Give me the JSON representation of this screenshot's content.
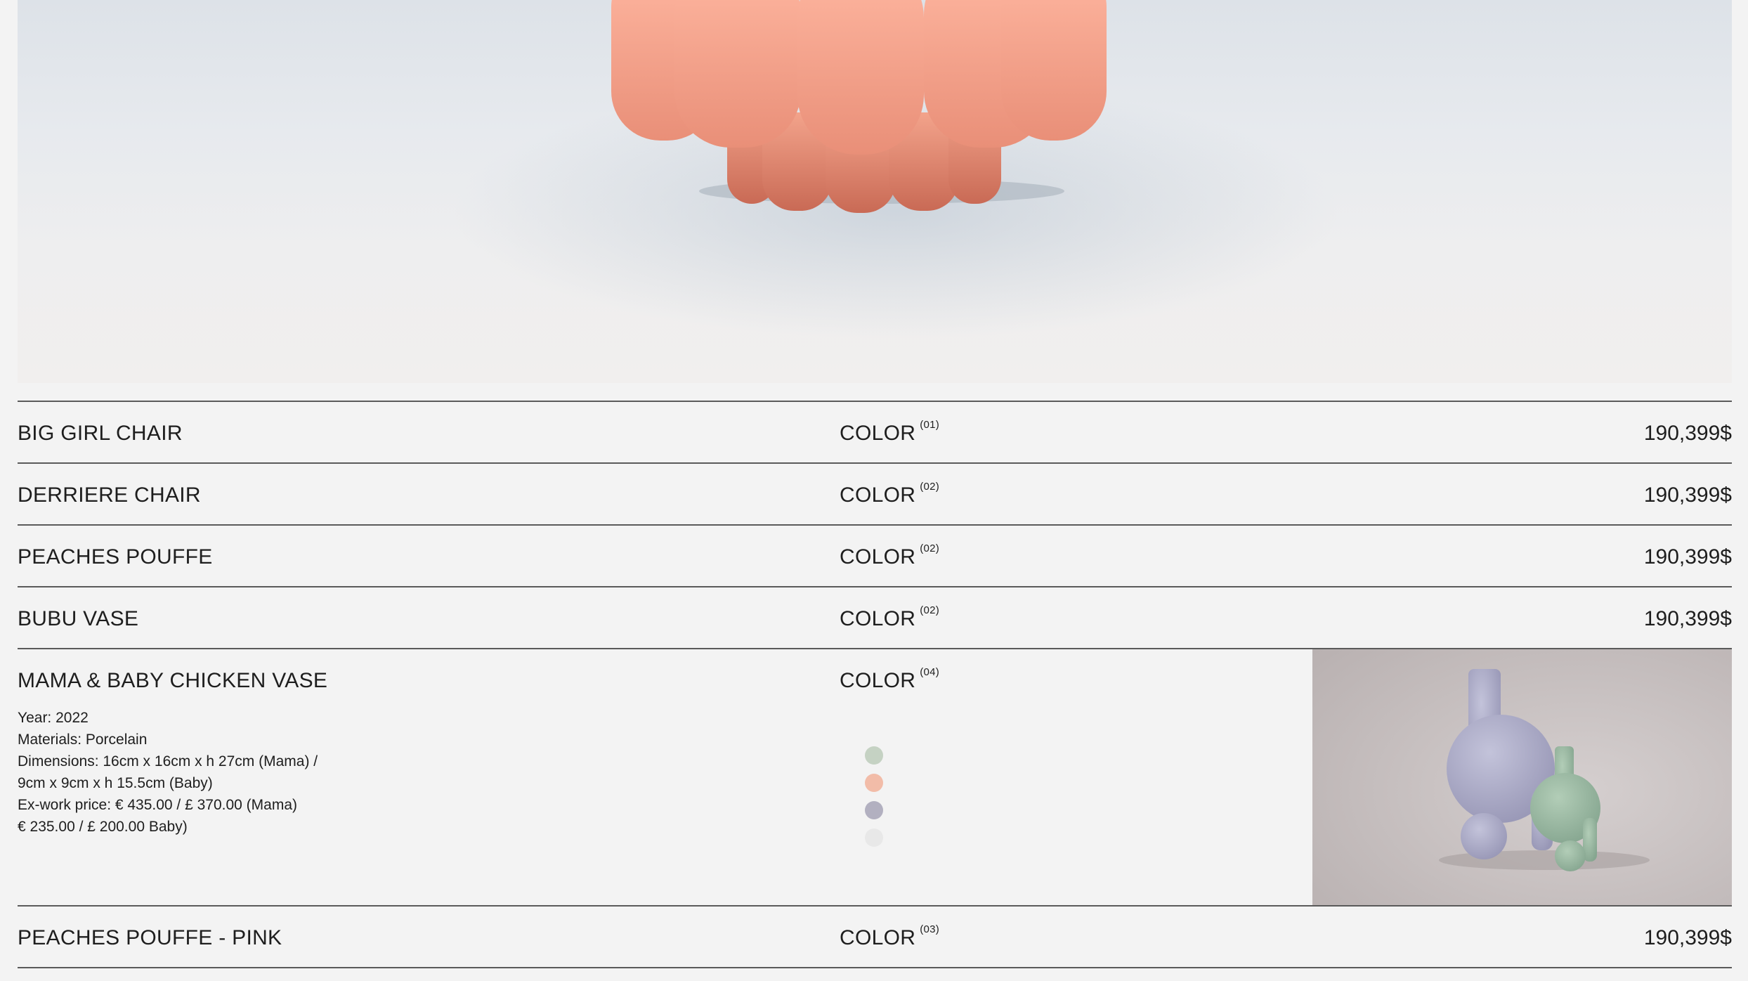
{
  "hero": {
    "image": "pink-pouffe-photo"
  },
  "products": [
    {
      "name": "BIG GIRL CHAIR",
      "color_label": "COLOR",
      "color_count": "(01)",
      "price": "190,399$"
    },
    {
      "name": "DERRIERE CHAIR",
      "color_label": "COLOR",
      "color_count": "(02)",
      "price": "190,399$"
    },
    {
      "name": "PEACHES POUFFE",
      "color_label": "COLOR",
      "color_count": "(02)",
      "price": "190,399$"
    },
    {
      "name": "BUBU VASE",
      "color_label": "COLOR",
      "color_count": "(02)",
      "price": "190,399$"
    }
  ],
  "expanded": {
    "name": "MAMA & BABY CHICKEN VASE",
    "color_label": "COLOR",
    "color_count": "(04)",
    "details": [
      "Year: 2022",
      "Materials: Porcelain",
      "Dimensions: 16cm x 16cm x h 27cm (Mama) /",
      "9cm x 9cm x h 15.5cm (Baby)",
      "Ex-work price: € 435.00 / £ 370.00 (Mama)",
      "€ 235.00 / £ 200.00 Baby)"
    ],
    "swatches": [
      "#c5d2c3",
      "#f2bca8",
      "#b2b0c0",
      "#e8e8e8"
    ],
    "image": "chicken-vase-photo"
  },
  "last_product": {
    "name": "PEACHES POUFFE - PINK",
    "color_label": "COLOR",
    "color_count": "(03)",
    "price": "190,399$"
  }
}
